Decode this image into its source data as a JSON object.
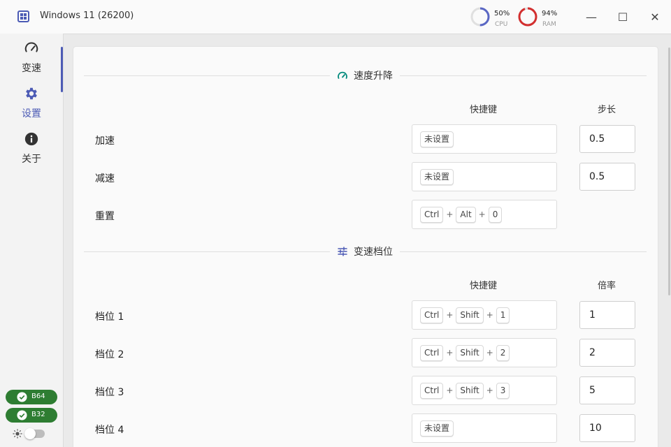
{
  "window": {
    "title": "Windows 11 (26200)"
  },
  "monitors": {
    "cpu": {
      "value": "50%",
      "label": "CPU",
      "fraction": 0.5,
      "color": "#5a67c4"
    },
    "ram": {
      "value": "94%",
      "label": "RAM",
      "fraction": 0.94,
      "color": "#d32f2f"
    }
  },
  "window_controls": {
    "minimize": "—",
    "maximize": "☐",
    "close": "✕"
  },
  "sidebar": {
    "items": [
      {
        "label": "变速",
        "icon": "speedometer-icon"
      },
      {
        "label": "设置",
        "icon": "gear-icon",
        "active": true
      },
      {
        "label": "关于",
        "icon": "info-icon"
      }
    ],
    "badges": [
      {
        "label": "B64",
        "icon": "check-circle-icon"
      },
      {
        "label": "B32",
        "icon": "check-circle-icon"
      }
    ],
    "theme_toggle": {
      "icon": "sun-icon",
      "on": false
    }
  },
  "colors": {
    "accent": "#4c5bb5",
    "teal": "#00897b",
    "badge_green": "#2e7d32"
  },
  "speed_section": {
    "title": "速度升降",
    "icon": "speedometer-icon",
    "col_hotkey": "快捷键",
    "col_step": "步长",
    "rows": [
      {
        "label": "加速",
        "keys": [
          "未设置"
        ],
        "step": "0.5"
      },
      {
        "label": "减速",
        "keys": [
          "未设置"
        ],
        "step": "0.5"
      },
      {
        "label": "重置",
        "keys": [
          "Ctrl",
          "Alt",
          "0"
        ]
      }
    ]
  },
  "gear_section": {
    "title": "变速档位",
    "icon": "sliders-icon",
    "col_hotkey": "快捷键",
    "col_rate": "倍率",
    "rows": [
      {
        "label": "档位 1",
        "keys": [
          "Ctrl",
          "Shift",
          "1"
        ],
        "rate": "1"
      },
      {
        "label": "档位 2",
        "keys": [
          "Ctrl",
          "Shift",
          "2"
        ],
        "rate": "2"
      },
      {
        "label": "档位 3",
        "keys": [
          "Ctrl",
          "Shift",
          "3"
        ],
        "rate": "5"
      },
      {
        "label": "档位 4",
        "keys": [
          "未设置"
        ],
        "rate": "10"
      }
    ]
  },
  "plus_sign": "+"
}
